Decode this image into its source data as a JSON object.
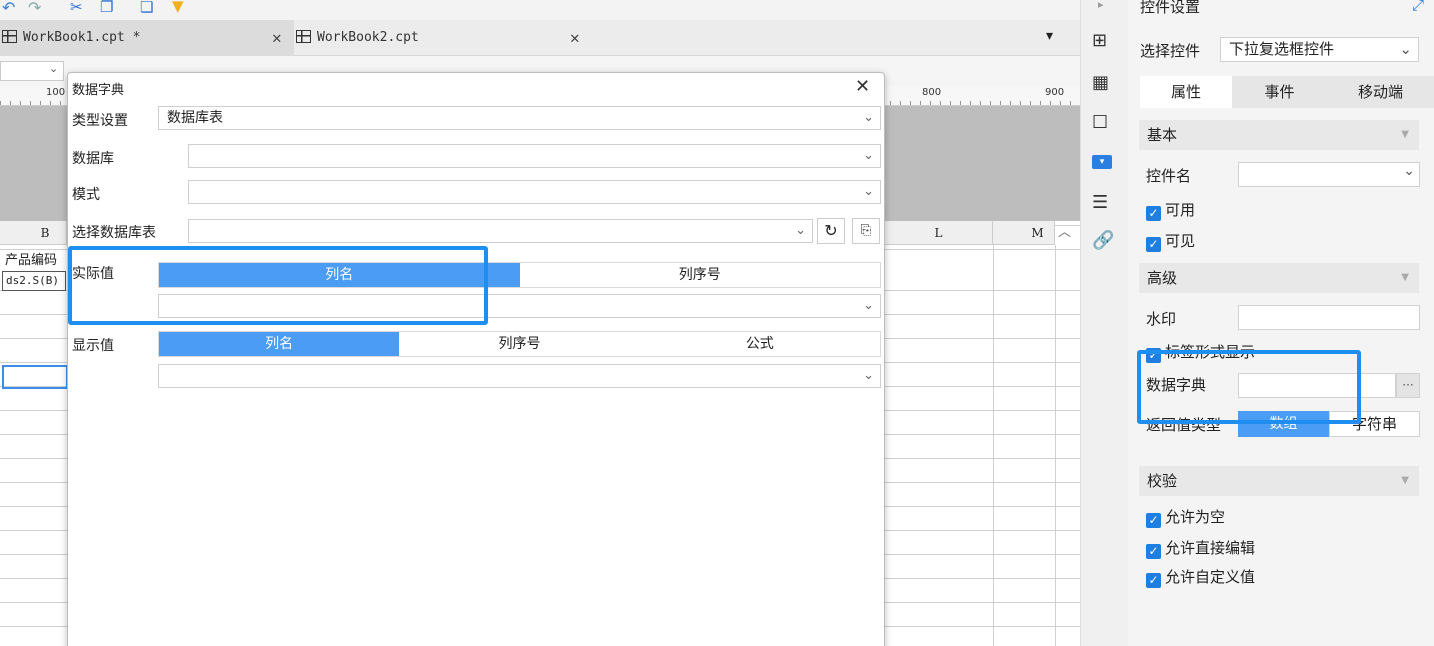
{
  "workbook_tabs": [
    {
      "label": "WorkBook1.cpt *"
    },
    {
      "label": "WorkBook2.cpt"
    }
  ],
  "ruler": {
    "marks": [
      "100",
      "800",
      "900"
    ]
  },
  "sheet": {
    "columns": [
      "B",
      "L",
      "M"
    ],
    "cells": {
      "b_header": "产品编码",
      "b_formula": "ds2.S(B)"
    }
  },
  "dialog": {
    "title": "数据字典",
    "type_label": "类型设置",
    "type_value": "数据库表",
    "database_label": "数据库",
    "schema_label": "模式",
    "table_label": "选择数据库表",
    "actual_label": "实际值",
    "actual_options": [
      "列名",
      "列序号"
    ],
    "display_label": "显示值",
    "display_options": [
      "列名",
      "列序号",
      "公式"
    ]
  },
  "panel": {
    "title": "控件设置",
    "select_control_label": "选择控件",
    "select_control_value": "下拉复选框控件",
    "tabs": [
      "属性",
      "事件",
      "移动端"
    ],
    "basic": {
      "title": "基本",
      "name_label": "控件名",
      "enabled_label": "可用",
      "visible_label": "可见"
    },
    "advanced": {
      "title": "高级",
      "watermark_label": "水印",
      "tag_display_label": "标签形式显示",
      "dictionary_label": "数据字典",
      "more_button": "···",
      "return_type_label": "返回值类型",
      "return_type_options": [
        "数组",
        "字符串"
      ]
    },
    "validate": {
      "title": "校验",
      "allow_empty": "允许为空",
      "allow_edit": "允许直接编辑",
      "allow_custom": "允许自定义值"
    }
  },
  "colors": {
    "accent": "#4a9cf5",
    "highlight": "#1f8ef1",
    "checkbox": "#1e7fe0"
  }
}
